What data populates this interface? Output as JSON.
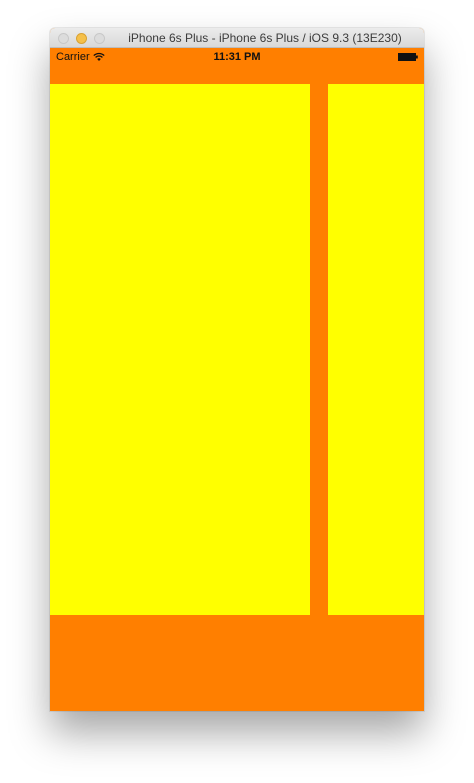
{
  "window": {
    "title": "iPhone 6s Plus - iPhone 6s Plus / iOS 9.3 (13E230)"
  },
  "statusbar": {
    "carrier": "Carrier",
    "time": "11:31 PM"
  },
  "colors": {
    "background": "#ff7f00",
    "panel": "#ffff00"
  },
  "icons": {
    "wifi": "wifi-icon",
    "battery": "battery-icon"
  }
}
